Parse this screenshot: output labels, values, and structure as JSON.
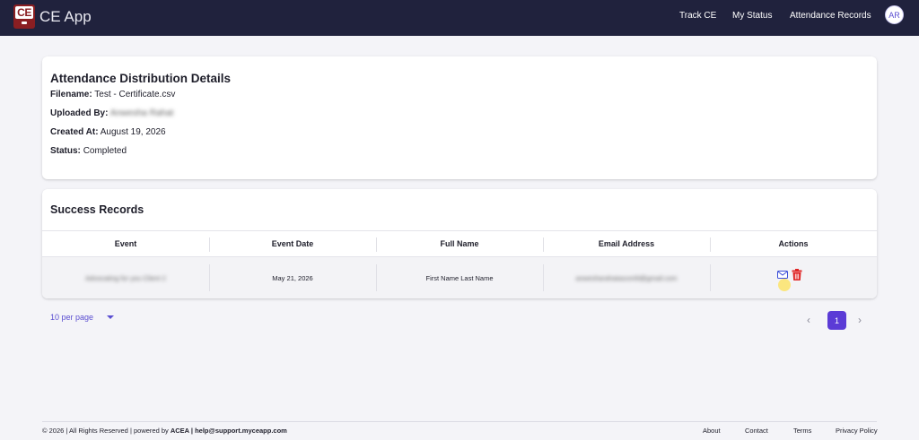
{
  "header": {
    "logo_text": "CE",
    "app_title": "CE App",
    "nav": [
      "Track CE",
      "My Status",
      "Attendance Records"
    ],
    "avatar_initials": "AR",
    "bg_color": "#20223d"
  },
  "details": {
    "title": "Attendance Distribution Details",
    "filename_label": "Filename:",
    "filename": "Test - Certificate.csv",
    "uploaded_label": "Uploaded By:",
    "uploaded_by": "Anwesha Rahat",
    "created_label": "Created At:",
    "created_at": "August 19, 2026",
    "status_label": "Status:",
    "status": "Completed"
  },
  "success": {
    "title": "Success Records",
    "columns": [
      "Event",
      "Event Date",
      "Full Name",
      "Email Address",
      "Actions"
    ],
    "rows": [
      {
        "event": "Advocating for you Client 2",
        "event_date": "May 21, 2026",
        "full_name": "First Name Last Name",
        "email": "anwesharahatasce49@gmail.com",
        "actions": [
          "mail-icon",
          "trash-icon"
        ]
      }
    ]
  },
  "pagination": {
    "per_page": "10 per page",
    "prev": "‹",
    "current_page": "1",
    "next": "›",
    "accent": "#5b3bd6"
  },
  "footer": {
    "copyright_prefix": "© 2026 | All Rights Reserved | powered by ",
    "brand": "ACEA | help@support.myceapp.com",
    "links": [
      "About",
      "Contact",
      "Terms",
      "Privacy Policy"
    ]
  }
}
